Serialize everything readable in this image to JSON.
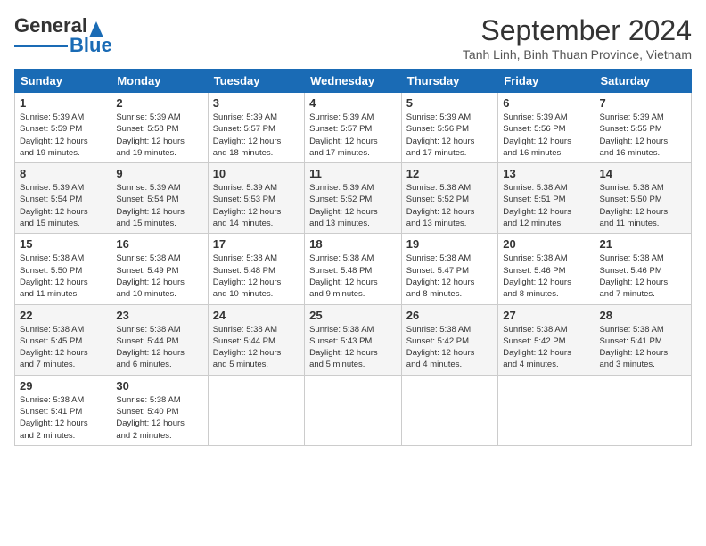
{
  "logo": {
    "line1": "General",
    "line2": "Blue"
  },
  "title": "September 2024",
  "location": "Tanh Linh, Binh Thuan Province, Vietnam",
  "days_of_week": [
    "Sunday",
    "Monday",
    "Tuesday",
    "Wednesday",
    "Thursday",
    "Friday",
    "Saturday"
  ],
  "weeks": [
    [
      {
        "day": "1",
        "rise": "5:39 AM",
        "set": "5:59 PM",
        "hours": "12",
        "minutes": "19"
      },
      {
        "day": "2",
        "rise": "5:39 AM",
        "set": "5:58 PM",
        "hours": "12",
        "minutes": "19"
      },
      {
        "day": "3",
        "rise": "5:39 AM",
        "set": "5:57 PM",
        "hours": "12",
        "minutes": "18"
      },
      {
        "day": "4",
        "rise": "5:39 AM",
        "set": "5:57 PM",
        "hours": "12",
        "minutes": "17"
      },
      {
        "day": "5",
        "rise": "5:39 AM",
        "set": "5:56 PM",
        "hours": "12",
        "minutes": "17"
      },
      {
        "day": "6",
        "rise": "5:39 AM",
        "set": "5:56 PM",
        "hours": "12",
        "minutes": "16"
      },
      {
        "day": "7",
        "rise": "5:39 AM",
        "set": "5:55 PM",
        "hours": "12",
        "minutes": "16"
      }
    ],
    [
      {
        "day": "8",
        "rise": "5:39 AM",
        "set": "5:54 PM",
        "hours": "12",
        "minutes": "15"
      },
      {
        "day": "9",
        "rise": "5:39 AM",
        "set": "5:54 PM",
        "hours": "12",
        "minutes": "15"
      },
      {
        "day": "10",
        "rise": "5:39 AM",
        "set": "5:53 PM",
        "hours": "12",
        "minutes": "14"
      },
      {
        "day": "11",
        "rise": "5:39 AM",
        "set": "5:52 PM",
        "hours": "12",
        "minutes": "13"
      },
      {
        "day": "12",
        "rise": "5:38 AM",
        "set": "5:52 PM",
        "hours": "12",
        "minutes": "13"
      },
      {
        "day": "13",
        "rise": "5:38 AM",
        "set": "5:51 PM",
        "hours": "12",
        "minutes": "12"
      },
      {
        "day": "14",
        "rise": "5:38 AM",
        "set": "5:50 PM",
        "hours": "12",
        "minutes": "11"
      }
    ],
    [
      {
        "day": "15",
        "rise": "5:38 AM",
        "set": "5:50 PM",
        "hours": "12",
        "minutes": "11"
      },
      {
        "day": "16",
        "rise": "5:38 AM",
        "set": "5:49 PM",
        "hours": "12",
        "minutes": "10"
      },
      {
        "day": "17",
        "rise": "5:38 AM",
        "set": "5:48 PM",
        "hours": "12",
        "minutes": "10"
      },
      {
        "day": "18",
        "rise": "5:38 AM",
        "set": "5:48 PM",
        "hours": "12",
        "minutes": "9"
      },
      {
        "day": "19",
        "rise": "5:38 AM",
        "set": "5:47 PM",
        "hours": "12",
        "minutes": "8"
      },
      {
        "day": "20",
        "rise": "5:38 AM",
        "set": "5:46 PM",
        "hours": "12",
        "minutes": "8"
      },
      {
        "day": "21",
        "rise": "5:38 AM",
        "set": "5:46 PM",
        "hours": "12",
        "minutes": "7"
      }
    ],
    [
      {
        "day": "22",
        "rise": "5:38 AM",
        "set": "5:45 PM",
        "hours": "12",
        "minutes": "7"
      },
      {
        "day": "23",
        "rise": "5:38 AM",
        "set": "5:44 PM",
        "hours": "12",
        "minutes": "6"
      },
      {
        "day": "24",
        "rise": "5:38 AM",
        "set": "5:44 PM",
        "hours": "12",
        "minutes": "5"
      },
      {
        "day": "25",
        "rise": "5:38 AM",
        "set": "5:43 PM",
        "hours": "12",
        "minutes": "5"
      },
      {
        "day": "26",
        "rise": "5:38 AM",
        "set": "5:42 PM",
        "hours": "12",
        "minutes": "4"
      },
      {
        "day": "27",
        "rise": "5:38 AM",
        "set": "5:42 PM",
        "hours": "12",
        "minutes": "4"
      },
      {
        "day": "28",
        "rise": "5:38 AM",
        "set": "5:41 PM",
        "hours": "12",
        "minutes": "3"
      }
    ],
    [
      {
        "day": "29",
        "rise": "5:38 AM",
        "set": "5:41 PM",
        "hours": "12",
        "minutes": "2"
      },
      {
        "day": "30",
        "rise": "5:38 AM",
        "set": "5:40 PM",
        "hours": "12",
        "minutes": "2"
      },
      null,
      null,
      null,
      null,
      null
    ]
  ]
}
